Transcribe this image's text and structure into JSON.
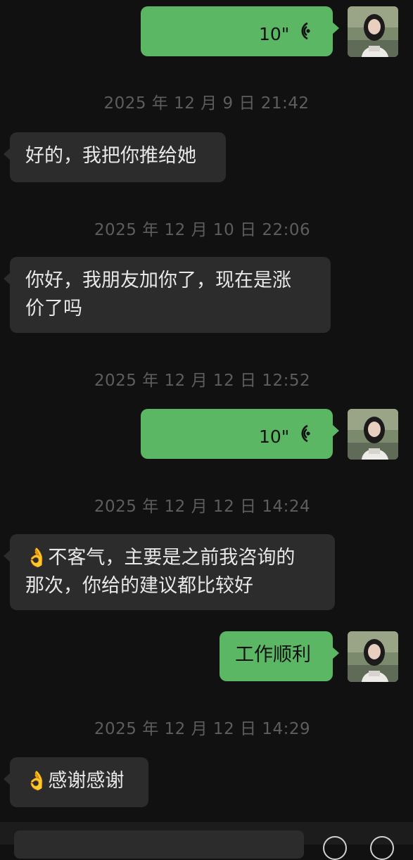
{
  "colors": {
    "background": "#111111",
    "bubble_incoming": "#2c2c2c",
    "bubble_outgoing": "#5bb764",
    "timestamp": "#5d5d5d"
  },
  "messages": [
    {
      "type": "voice",
      "side": "right",
      "duration": "10\""
    },
    {
      "type": "timestamp",
      "text": "2025 年 12 月 9 日 21:42"
    },
    {
      "type": "text",
      "side": "left",
      "text": "好的，我把你推给她"
    },
    {
      "type": "timestamp",
      "text": "2025 年 12 月 10 日 22:06"
    },
    {
      "type": "text",
      "side": "left",
      "line1": "你好，我朋友加你了，现在是涨",
      "line2": "价了吗"
    },
    {
      "type": "timestamp",
      "text": "2025 年 12 月 12 日 12:52"
    },
    {
      "type": "voice",
      "side": "right",
      "duration": "10\""
    },
    {
      "type": "timestamp",
      "text": "2025 年 12 月 12 日 14:24"
    },
    {
      "type": "text",
      "side": "left",
      "emoji": "👌",
      "line1": "不客气，主要是之前我咨询的",
      "line2": "那次，你给的建议都比较好"
    },
    {
      "type": "text",
      "side": "right",
      "text": "工作顺利"
    },
    {
      "type": "timestamp",
      "text": "2025 年 12 月 12 日 14:29"
    },
    {
      "type": "text",
      "side": "left",
      "emoji": "👌",
      "text": "感谢感谢"
    }
  ],
  "icons": {
    "voice": "voice-wave-icon",
    "avatar": "user-avatar"
  }
}
